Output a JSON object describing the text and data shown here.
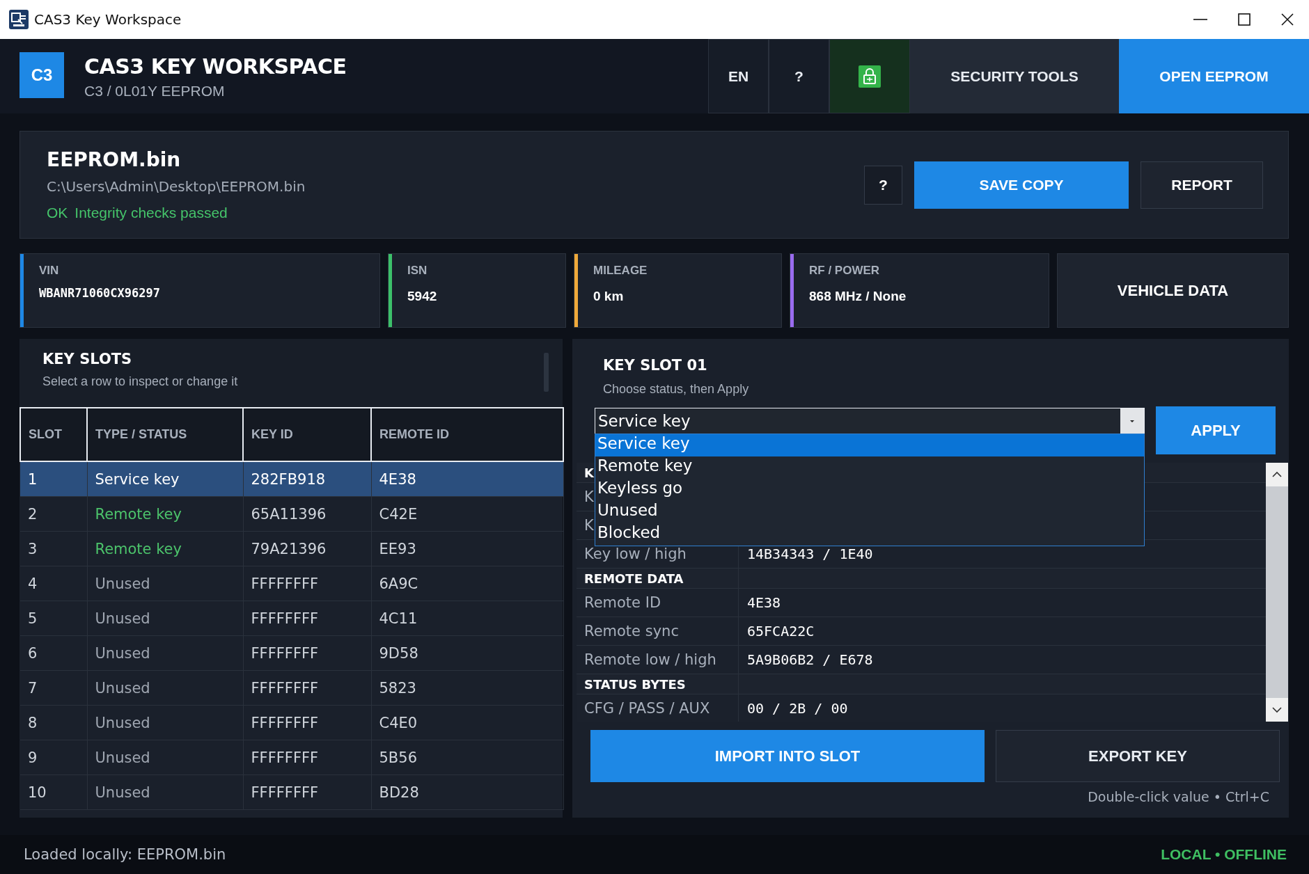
{
  "window": {
    "title": "CAS3 Key Workspace"
  },
  "header": {
    "logo": "C3",
    "title": "CAS3 KEY WORKSPACE",
    "subtitle": "C3 / 0L01Y EEPROM",
    "buttons": [
      {
        "kind": "text",
        "label": "EN"
      },
      {
        "kind": "text",
        "label": "?"
      },
      {
        "kind": "icon"
      },
      {
        "kind": "text",
        "label": "SECURITY TOOLS"
      },
      {
        "kind": "primary",
        "label": "OPEN EEPROM"
      }
    ]
  },
  "file": {
    "name": "EEPROM.bin",
    "path": "C:\\Users\\Admin\\Desktop\\EEPROM.bin",
    "status_code": "OK",
    "status_text": "Integrity checks passed",
    "buttons": [
      {
        "kind": "help",
        "label": "?"
      },
      {
        "kind": "primary",
        "label": "SAVE COPY"
      },
      {
        "kind": "secondary",
        "label": "REPORT"
      }
    ]
  },
  "info_cards": [
    {
      "label": "VIN",
      "value": "WBANR71060CX96297",
      "color": "#1e88e5",
      "mono": true
    },
    {
      "label": "ISN",
      "value": "5942",
      "color": "#3cc06a",
      "mono": false
    },
    {
      "label": "MILEAGE",
      "value": "0 km",
      "color": "#f0a93a",
      "mono": false
    },
    {
      "label": "RF / POWER",
      "value": "868 MHz / None",
      "color": "#9a6cf0",
      "mono": false
    }
  ],
  "vehicle_data_button": "VEHICLE DATA",
  "slots": {
    "title": "KEY SLOTS",
    "subtitle": "Select a row to inspect or change it",
    "columns": [
      "SLOT",
      "TYPE / STATUS",
      "KEY ID",
      "REMOTE ID"
    ],
    "rows": [
      {
        "slot": "1",
        "type": "Service key",
        "kind": "service",
        "key_id": "282FB918",
        "remote_id": "4E38",
        "selected": true
      },
      {
        "slot": "2",
        "type": "Remote key",
        "kind": "remote",
        "key_id": "65A11396",
        "remote_id": "C42E",
        "selected": false
      },
      {
        "slot": "3",
        "type": "Remote key",
        "kind": "remote",
        "key_id": "79A21396",
        "remote_id": "EE93",
        "selected": false
      },
      {
        "slot": "4",
        "type": "Unused",
        "kind": "unused",
        "key_id": "FFFFFFFF",
        "remote_id": "6A9C",
        "selected": false
      },
      {
        "slot": "5",
        "type": "Unused",
        "kind": "unused",
        "key_id": "FFFFFFFF",
        "remote_id": "4C11",
        "selected": false
      },
      {
        "slot": "6",
        "type": "Unused",
        "kind": "unused",
        "key_id": "FFFFFFFF",
        "remote_id": "9D58",
        "selected": false
      },
      {
        "slot": "7",
        "type": "Unused",
        "kind": "unused",
        "key_id": "FFFFFFFF",
        "remote_id": "5823",
        "selected": false
      },
      {
        "slot": "8",
        "type": "Unused",
        "kind": "unused",
        "key_id": "FFFFFFFF",
        "remote_id": "C4E0",
        "selected": false
      },
      {
        "slot": "9",
        "type": "Unused",
        "kind": "unused",
        "key_id": "FFFFFFFF",
        "remote_id": "5B56",
        "selected": false
      },
      {
        "slot": "10",
        "type": "Unused",
        "kind": "unused",
        "key_id": "FFFFFFFF",
        "remote_id": "BD28",
        "selected": false
      }
    ]
  },
  "detail": {
    "title": "KEY SLOT 01",
    "subtitle": "Choose status, then Apply",
    "select": {
      "value": "Service key",
      "expanded": true,
      "options": [
        {
          "label": "Service key",
          "selected": true
        },
        {
          "label": "Remote key",
          "selected": false
        },
        {
          "label": "Keyless go",
          "selected": false
        },
        {
          "label": "Unused",
          "selected": false
        },
        {
          "label": "Blocked",
          "selected": false
        }
      ]
    },
    "apply_button": "APPLY",
    "rows": [
      {
        "kind": "section",
        "label": "K"
      },
      {
        "kind": "field",
        "label": "K"
      },
      {
        "kind": "field",
        "label": "K"
      },
      {
        "kind": "field",
        "label": "Key low / high",
        "value": "14B34343 / 1E40"
      },
      {
        "kind": "section",
        "label": "REMOTE DATA"
      },
      {
        "kind": "field",
        "label": "Remote ID",
        "value": "4E38"
      },
      {
        "kind": "field",
        "label": "Remote sync",
        "value": "65FCA22C"
      },
      {
        "kind": "field",
        "label": "Remote low / high",
        "value": "5A9B06B2 / E678"
      },
      {
        "kind": "section",
        "label": "STATUS BYTES"
      },
      {
        "kind": "field",
        "label": "CFG / PASS / AUX",
        "value": "00 / 2B / 00"
      }
    ],
    "import_button": "IMPORT INTO SLOT",
    "export_button": "EXPORT KEY",
    "hint": "Double-click value • Ctrl+C"
  },
  "status_bar": {
    "left": "Loaded locally: EEPROM.bin",
    "right": "LOCAL • OFFLINE"
  }
}
